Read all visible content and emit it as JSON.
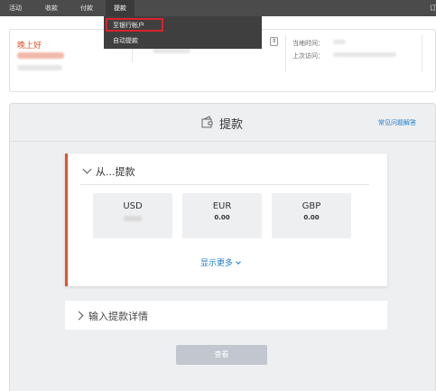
{
  "nav": {
    "items": [
      "活动",
      "收款",
      "付款",
      "提款"
    ],
    "right_edge": "订"
  },
  "dropdown": {
    "items": [
      "至银行帐户",
      "自动提款"
    ]
  },
  "summary": {
    "greeting": "晚上好",
    "local_time_label": "当地时间：",
    "last_visit_label": "上次访问："
  },
  "panel": {
    "title": "提款",
    "faq_link": "常见问题解答",
    "withdraw_from": "从...提款",
    "currencies": [
      {
        "code": "USD",
        "amount": ""
      },
      {
        "code": "EUR",
        "amount": "0.00"
      },
      {
        "code": "GBP",
        "amount": "0.00"
      }
    ],
    "show_more": "显示更多",
    "details_title": "输入提款详情",
    "view_button": "查看"
  },
  "colors": {
    "accent": "#e0542a",
    "link": "#1e7ccc",
    "nav_bg": "#4b4b4b",
    "highlight_box": "#d9232e"
  }
}
